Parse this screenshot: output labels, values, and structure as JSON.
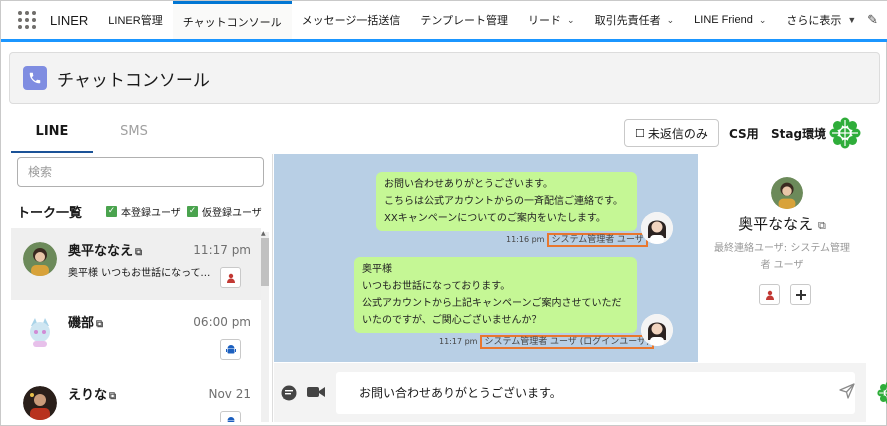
{
  "nav": {
    "app_name": "LINER",
    "tabs": [
      {
        "label": "LINER管理",
        "dropdown": false
      },
      {
        "label": "チャットコンソール",
        "dropdown": false,
        "active": true
      },
      {
        "label": "メッセージ一括送信",
        "dropdown": false
      },
      {
        "label": "テンプレート管理",
        "dropdown": false
      },
      {
        "label": "リード",
        "dropdown": true
      },
      {
        "label": "取引先責任者",
        "dropdown": true
      },
      {
        "label": "LINE Friend",
        "dropdown": true
      },
      {
        "label": "さらに表示",
        "dropdown": true
      }
    ],
    "chevron": "⌄",
    "more_chevron": "▼",
    "edit_icon": "pencil-icon"
  },
  "header": {
    "title": "チャットコンソール",
    "icon": "phone-icon"
  },
  "channel_tabs": {
    "line": "LINE",
    "sms": "SMS"
  },
  "toolbar": {
    "unread_label": "未返信のみ",
    "cs_label": "CS用",
    "env_label": "Stag環境"
  },
  "sidebar": {
    "search_placeholder": "検索",
    "talk_list_title": "トーク一覧",
    "filters": [
      {
        "label": "本登録ユーザ",
        "checked": true
      },
      {
        "label": "仮登録ユーザ",
        "checked": true
      }
    ],
    "contacts": [
      {
        "name": "奥平ななえ",
        "time": "11:17 pm",
        "preview": "奥平様 いつもお世話になっております…",
        "badge": "user-icon",
        "badge_color": "#c23934",
        "selected": true
      },
      {
        "name": "磯部",
        "time": "06:00 pm",
        "preview": "",
        "badge": "android-icon",
        "badge_color": "#1b5fbf",
        "selected": false
      },
      {
        "name": "えりな",
        "time": "Nov 21",
        "preview": "",
        "badge": "android-icon",
        "badge_color": "#1b5fbf",
        "selected": false
      }
    ]
  },
  "chat": {
    "messages": [
      {
        "lines": [
          "お問い合わせありがとうございます。",
          "こちらは公式アカウントからの一斉配信ご連絡です。",
          "XXキャンペーンについてのご案内をいたします。"
        ],
        "time": "11:16 pm",
        "sender": "システム管理者 ユーザ"
      },
      {
        "lines": [
          "奥平様",
          "いつもお世話になっております。",
          "公式アカウントから上記キャンペーンご案内させていただ",
          "いたのですが、ご関心ございませんか？"
        ],
        "time": "11:17 pm",
        "sender": "システム管理者 ユーザ (ログインユーザ)"
      }
    ]
  },
  "profile": {
    "name": "奥平ななえ",
    "last_contact": "最終連絡ユーザ: システム管理者 ユーザ"
  },
  "composer": {
    "text": "お問い合わせありがとうございます。"
  },
  "colors": {
    "accent": "#0176d3",
    "bubble": "#c5f795",
    "chat_bg": "#b8cfe5",
    "highlight": "#e8772e",
    "logo_green": "#2fad3a"
  }
}
